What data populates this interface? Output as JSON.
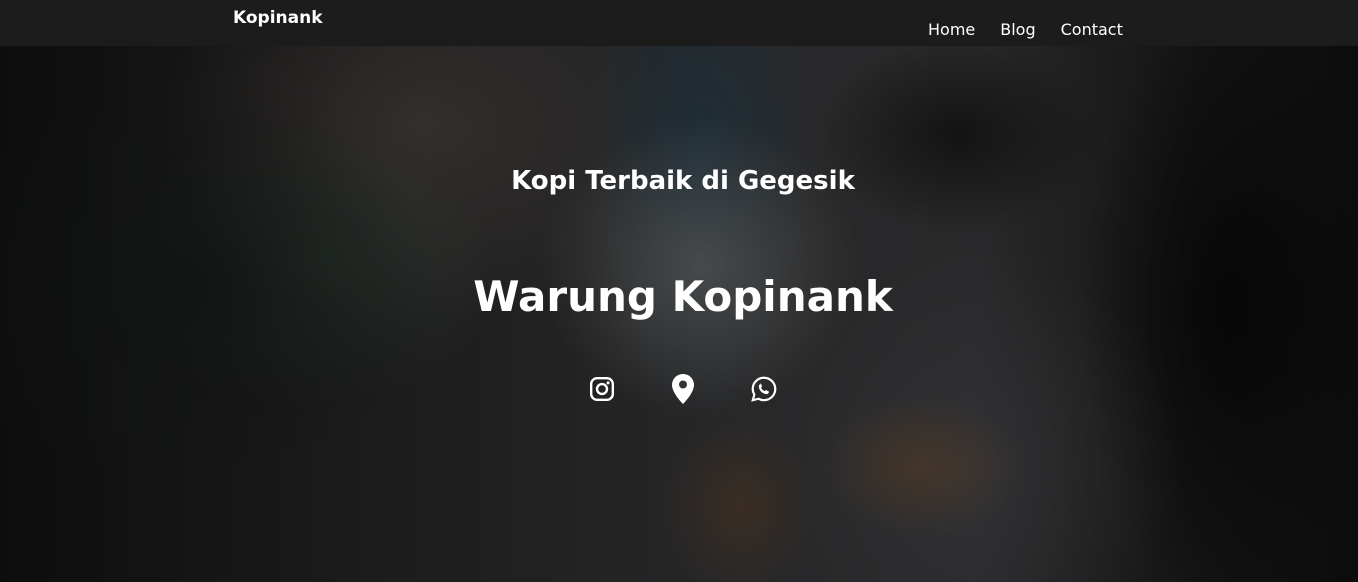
{
  "nav": {
    "brand": "Kopinank",
    "links": [
      "Home",
      "Blog",
      "Contact"
    ]
  },
  "hero": {
    "tagline": "Kopi Terbaik di Gegesik",
    "title": "Warung Kopinank"
  },
  "socials": [
    {
      "icon": "instagram-icon"
    },
    {
      "icon": "map-pin-icon"
    },
    {
      "icon": "whatsapp-icon"
    }
  ],
  "colors": {
    "navbar": "#1c1c1c",
    "text": "#ffffff"
  }
}
